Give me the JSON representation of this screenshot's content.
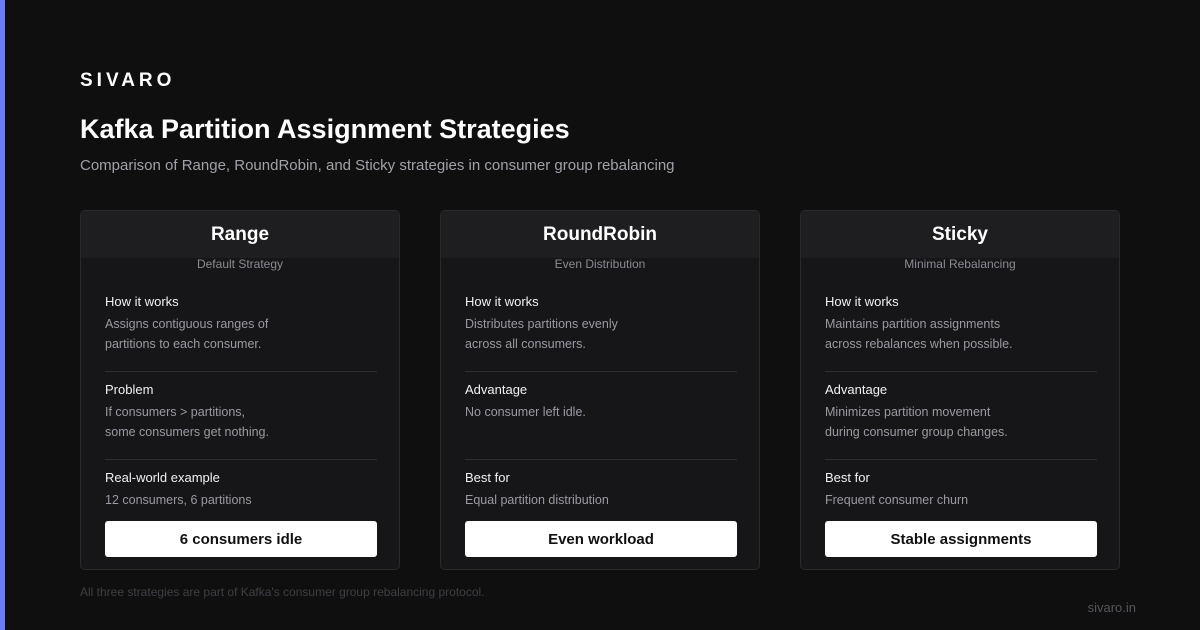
{
  "brand": "SIVARO",
  "title": "Kafka Partition Assignment Strategies",
  "subtitle": "Comparison of Range, RoundRobin, and Sticky strategies in consumer group rebalancing",
  "cards": [
    {
      "title": "Range",
      "tag": "Default Strategy",
      "s1_label": "How it works",
      "s1_line1": "Assigns contiguous ranges of",
      "s1_line2": "partitions to each consumer.",
      "s2_label": "Problem",
      "s2_line1": "If consumers > partitions,",
      "s2_line2": "some consumers get nothing.",
      "s3_label": "Real-world example",
      "s3_text": "12 consumers, 6 partitions",
      "pill": "6 consumers idle"
    },
    {
      "title": "RoundRobin",
      "tag": "Even Distribution",
      "s1_label": "How it works",
      "s1_line1": "Distributes partitions evenly",
      "s1_line2": "across all consumers.",
      "s2_label": "Advantage",
      "s2_line1": "No consumer left idle.",
      "s2_line2": "",
      "s3_label": "Best for",
      "s3_text": "Equal partition distribution",
      "pill": "Even workload"
    },
    {
      "title": "Sticky",
      "tag": "Minimal Rebalancing",
      "s1_label": "How it works",
      "s1_line1": "Maintains partition assignments",
      "s1_line2": "across rebalances when possible.",
      "s2_label": "Advantage",
      "s2_line1": "Minimizes partition movement",
      "s2_line2": "during consumer group changes.",
      "s3_label": "Best for",
      "s3_text": "Frequent consumer churn",
      "pill": "Stable assignments"
    }
  ],
  "footnote": "All three strategies are part of Kafka's consumer group rebalancing protocol.",
  "site": "sivaro.in",
  "colors": {
    "accent": "#6b7cf6",
    "background": "#0f0f10",
    "card": "#161618"
  }
}
